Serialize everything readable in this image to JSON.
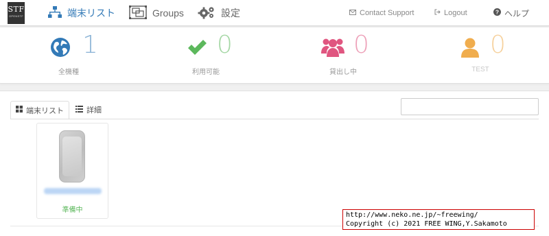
{
  "app": {
    "logo_top": "STF",
    "logo_bottom": "OPENSTF"
  },
  "nav": {
    "devices_label": "端末リスト",
    "groups_label": "Groups",
    "settings_label": "設定",
    "support_label": "Contact Support",
    "logout_label": "Logout",
    "help_label": "ヘルプ",
    "active_color": "#337ab7"
  },
  "stats": [
    {
      "value": "1",
      "label": "全機種",
      "icon": "globe-icon",
      "color": "#337ab7"
    },
    {
      "value": "0",
      "label": "利用可能",
      "icon": "check-icon",
      "color": "#5cb85c"
    },
    {
      "value": "0",
      "label": "貸出し中",
      "icon": "users-icon",
      "color": "#e05680"
    },
    {
      "value": "0",
      "label": "TEST",
      "icon": "user-icon",
      "color": "#f0ad4e"
    }
  ],
  "tabs": {
    "devices_label": "端末リスト",
    "details_label": "詳細"
  },
  "search": {
    "placeholder": "",
    "value": ""
  },
  "device": {
    "status": "準備中",
    "status_color": "#5cb85c"
  },
  "watermark": {
    "line1": "http://www.neko.ne.jp/~freewing/",
    "line2": "Copyright (c) 2021 FREE WING,Y.Sakamoto"
  }
}
